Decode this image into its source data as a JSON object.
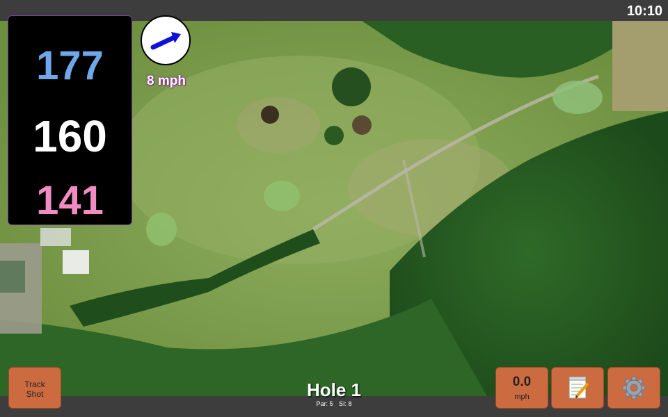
{
  "status": {
    "time": "10:10"
  },
  "distances": {
    "back": "177",
    "middle": "160",
    "front": "141"
  },
  "wind": {
    "speed_label": "8 mph",
    "arrow_icon": "arrow-right-icon",
    "value": "0.0",
    "unit": "mph"
  },
  "hole": {
    "title": "Hole 1",
    "par": "Par: 5",
    "si": "SI: 8"
  },
  "buttons": {
    "track_shot": "Track\nShot"
  },
  "icons": {
    "notes": "notepad-icon",
    "settings": "gear-icon"
  },
  "colors": {
    "back": "#6fa8e8",
    "middle": "#ffffff",
    "front": "#f08cc2",
    "button": "#cd6b40",
    "bar": "#3d3d3d",
    "accent": "#7a3fa0"
  }
}
